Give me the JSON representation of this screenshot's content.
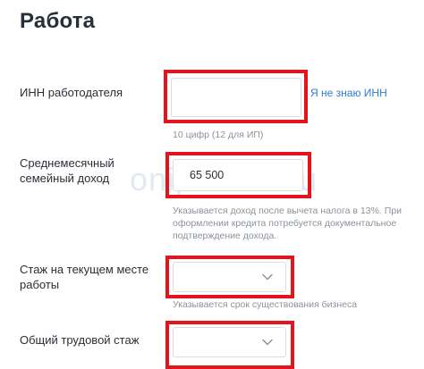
{
  "page": {
    "title": "Работа"
  },
  "watermark": {
    "text": "onipoteka.ru"
  },
  "employer_inn": {
    "label": "ИНН работодателя",
    "value": "",
    "hint": "10 цифр (12 для ИП)",
    "link": "Я не знаю ИНН"
  },
  "income": {
    "label_line1": "Среднемесячный",
    "label_line2": "семейный доход",
    "value": "65 500",
    "hint_line1": "Указывается доход после вычета налога в 13%. При",
    "hint_line2": "оформлении кредита потребуется документальное",
    "hint_line3": "подтверждение дохода."
  },
  "current_experience": {
    "label_line1": "Стаж на текущем месте",
    "label_line2": "работы",
    "selected": "",
    "hint": "Указывается срок существования бизнеса"
  },
  "total_experience": {
    "label": "Общий трудовой стаж",
    "selected": ""
  },
  "colors": {
    "highlight": "#e3141c",
    "link": "#2f7bd6",
    "hint": "#8a939c"
  },
  "icons": {
    "dropdown": "chevron-down-icon"
  }
}
